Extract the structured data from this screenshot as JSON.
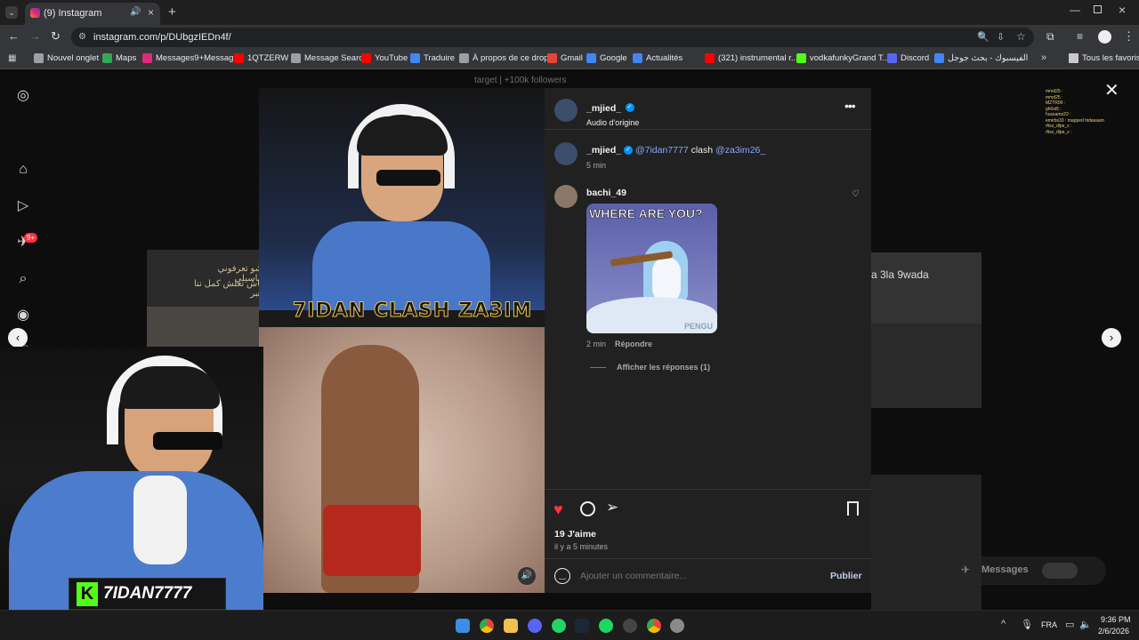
{
  "browser": {
    "tab_title": "(9) Instagram",
    "url": "instagram.com/p/DUbgzIEDn4f/",
    "bookmarks": [
      "Nouvel onglet",
      "Maps",
      "Messages9+Messag...",
      "1QTZERW",
      "Message Search",
      "YouTube",
      "Traduire",
      "À propos de ce drop",
      "Gmail",
      "Google",
      "Actualités",
      "(321) instrumental r...",
      "vodkafunkyGrand T...",
      "Discord",
      "الفيسبوك - بحث جوجل"
    ],
    "all_bookmarks": "Tous les favoris"
  },
  "background_feed": {
    "top_text": "target | +100k followers",
    "right_card_text": "a 3la 9wada",
    "left_card_text": "شو تعرفوني ماسيلي",
    "left_card_text2": "باش تعلش كمل ننا هبر"
  },
  "post": {
    "author": "_mjied_",
    "audio": "Audio d'origine",
    "caption_author": "_mjied_",
    "caption_mention1": "@7idan7777",
    "caption_word": "clash",
    "caption_mention2": "@za3im26_",
    "caption_time": "5 min",
    "video_title": "7IDAN CLASH ZA3IM",
    "comment": {
      "author": "bachi_49",
      "gif_text": "WHERE ARE YOU?",
      "gif_sub": "PENGU",
      "time": "2 min",
      "reply": "Répondre",
      "view_replies": "Afficher les réponses (1)"
    },
    "likes": "19 J'aime",
    "posted_ago": "il y a 5 minutes",
    "comment_placeholder": "Ajouter un commentaire...",
    "publish": "Publier"
  },
  "overlay": {
    "streamer_name": "7IDAN7777",
    "messages_label": "Messages",
    "nav_badge": "9+",
    "chat_lines": [
      "mmd25 :",
      "mmd25 :",
      "MZTR00 :",
      "gh0st5 :",
      "hussamo22 :",
      "emirbs33 : mapped hidasaam",
      "rfiss_dlpe_x :",
      "rfiss_dlpe_x :"
    ]
  },
  "taskbar": {
    "lang": "FRA",
    "time": "9:36 PM",
    "date": "2/6/2026"
  },
  "colors": {
    "heart": "#ff3040",
    "link_blue": "#8aa6ff",
    "verified": "#0095f6",
    "panel_bg": "#212121"
  }
}
